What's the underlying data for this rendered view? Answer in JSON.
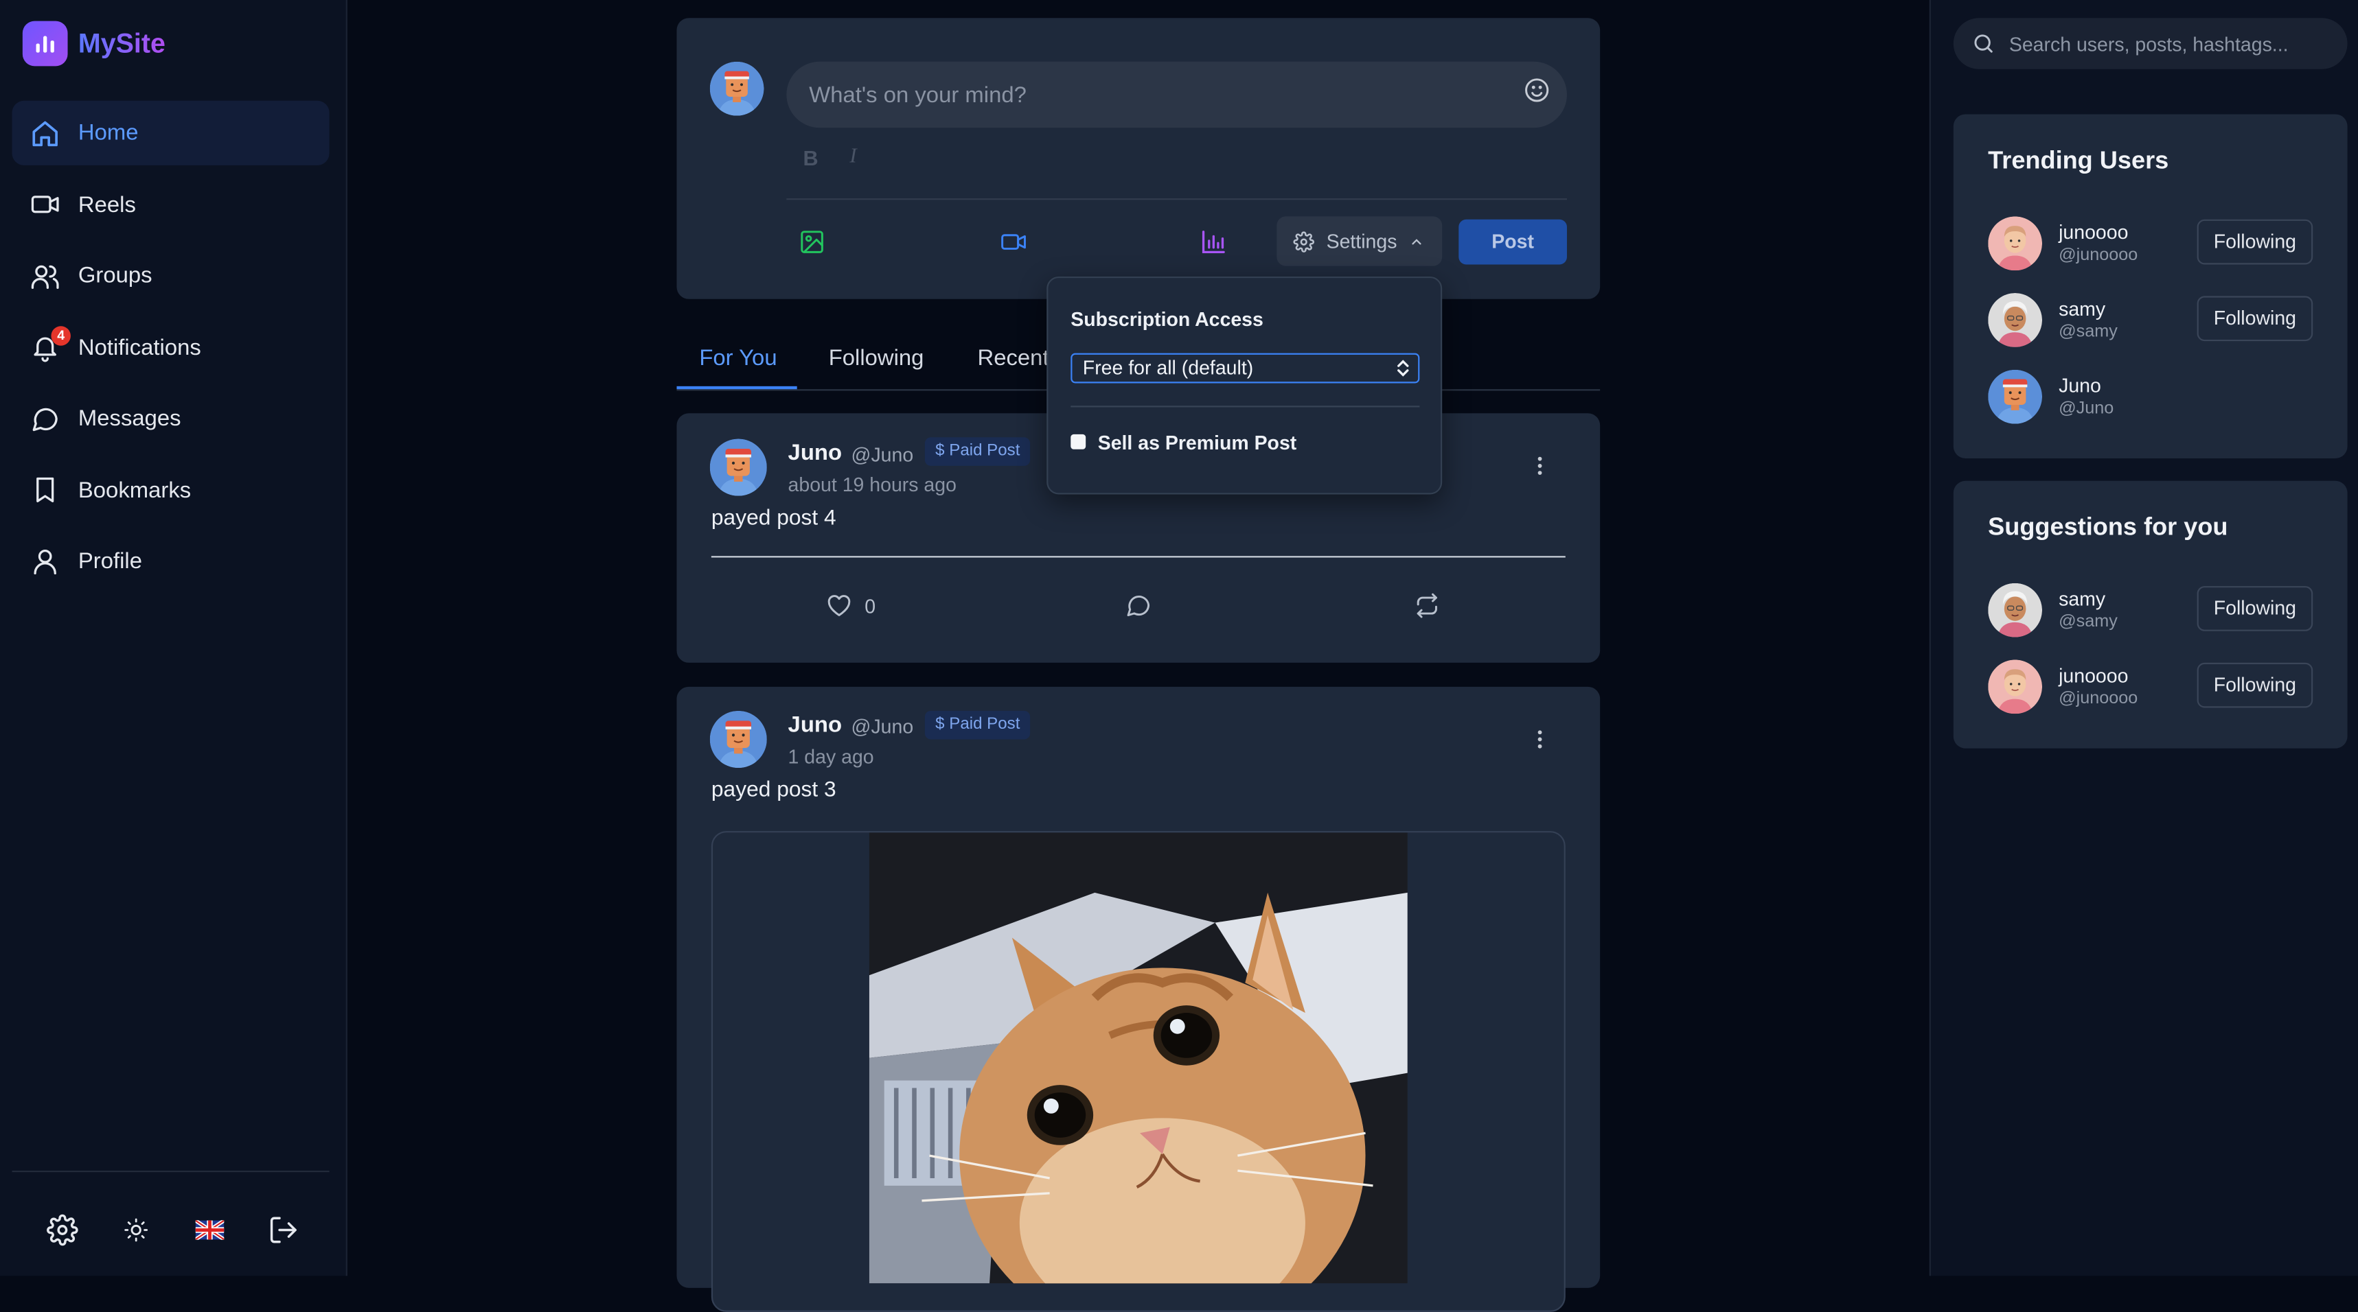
{
  "app": {
    "name": "MySite"
  },
  "nav": {
    "items": [
      {
        "label": "Home",
        "icon": "home-icon",
        "active": true
      },
      {
        "label": "Reels",
        "icon": "video-icon"
      },
      {
        "label": "Groups",
        "icon": "users-icon"
      },
      {
        "label": "Notifications",
        "icon": "bell-icon",
        "badge": "4"
      },
      {
        "label": "Messages",
        "icon": "message-circle-icon"
      },
      {
        "label": "Bookmarks",
        "icon": "bookmark-icon"
      },
      {
        "label": "Profile",
        "icon": "user-icon"
      }
    ],
    "footer_icons": [
      "settings-icon",
      "theme-sun-icon",
      "uk-flag-icon",
      "logout-icon"
    ]
  },
  "composer": {
    "placeholder": "What's on your mind?",
    "bold": "B",
    "italic": "I",
    "settings_label": "Settings",
    "post_label": "Post"
  },
  "subscription": {
    "title": "Subscription Access",
    "selected": "Free for all (default)",
    "premium_label": "Sell as Premium Post",
    "premium_checked": false
  },
  "tabs": [
    {
      "label": "For You",
      "active": true
    },
    {
      "label": "Following"
    },
    {
      "label": "Recent"
    }
  ],
  "posts": [
    {
      "author": "Juno",
      "handle": "@Juno",
      "badge": "$ Paid Post",
      "time": "about 19 hours ago",
      "text": "payed post 4",
      "likes": "0"
    },
    {
      "author": "Juno",
      "handle": "@Juno",
      "badge": "$ Paid Post",
      "time": "1 day ago",
      "text": "payed post 3"
    }
  ],
  "search": {
    "placeholder": "Search users, posts, hashtags..."
  },
  "trending": {
    "title": "Trending Users",
    "users": [
      {
        "name": "junoooo",
        "handle": "@junoooo",
        "button": "Following"
      },
      {
        "name": "samy",
        "handle": "@samy",
        "button": "Following"
      },
      {
        "name": "Juno",
        "handle": "@Juno"
      }
    ]
  },
  "suggestions": {
    "title": "Suggestions for you",
    "users": [
      {
        "name": "samy",
        "handle": "@samy",
        "button": "Following"
      },
      {
        "name": "junoooo",
        "handle": "@junoooo",
        "button": "Following"
      }
    ]
  },
  "colors": {
    "accent": "#3b82f6",
    "background": "#050a16",
    "card": "#1e293b",
    "sidebar": "#0b1222",
    "badge_red": "#e5352b"
  }
}
